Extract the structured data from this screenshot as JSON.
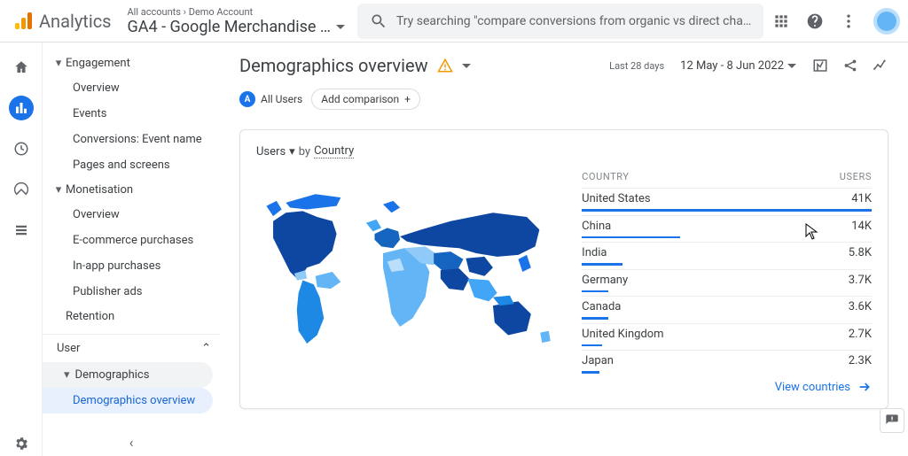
{
  "brand": "Analytics",
  "breadcrumbs": {
    "accounts": "All accounts",
    "account": "Demo Account"
  },
  "property": "GA4 - Google Merchandise …",
  "search_placeholder": "Try searching \"compare conversions from organic vs direct cha…",
  "nav": {
    "engagement": {
      "label": "Engagement",
      "items": [
        "Overview",
        "Events",
        "Conversions: Event name",
        "Pages and screens"
      ]
    },
    "monetisation": {
      "label": "Monetisation",
      "items": [
        "Overview",
        "E-commerce purchases",
        "In-app purchases",
        "Publisher ads"
      ]
    },
    "retention": "Retention",
    "user": "User",
    "demographics": "Demographics",
    "demo_overview": "Demographics overview"
  },
  "page_title": "Demographics overview",
  "date": {
    "label": "Last 28 days",
    "range": "12 May - 8 Jun 2022"
  },
  "chips": {
    "all_users": "All Users",
    "badge": "A",
    "add": "Add comparison"
  },
  "card": {
    "metric": "Users",
    "by": "by",
    "dimension": "Country",
    "header_country": "COUNTRY",
    "header_users": "USERS",
    "rows": [
      {
        "country": "United States",
        "users": "41K",
        "bar": 100
      },
      {
        "country": "China",
        "users": "14K",
        "bar": 34
      },
      {
        "country": "India",
        "users": "5.8K",
        "bar": 14
      },
      {
        "country": "Germany",
        "users": "3.7K",
        "bar": 9
      },
      {
        "country": "Canada",
        "users": "3.6K",
        "bar": 9
      },
      {
        "country": "United Kingdom",
        "users": "2.7K",
        "bar": 7
      },
      {
        "country": "Japan",
        "users": "2.3K",
        "bar": 6
      }
    ],
    "view": "View countries"
  },
  "chart_data": {
    "type": "table",
    "title": "Users by Country",
    "columns": [
      "Country",
      "Users"
    ],
    "rows": [
      [
        "United States",
        41000
      ],
      [
        "China",
        14000
      ],
      [
        "India",
        5800
      ],
      [
        "Germany",
        3700
      ],
      [
        "Canada",
        3600
      ],
      [
        "United Kingdom",
        2700
      ],
      [
        "Japan",
        2300
      ]
    ]
  }
}
